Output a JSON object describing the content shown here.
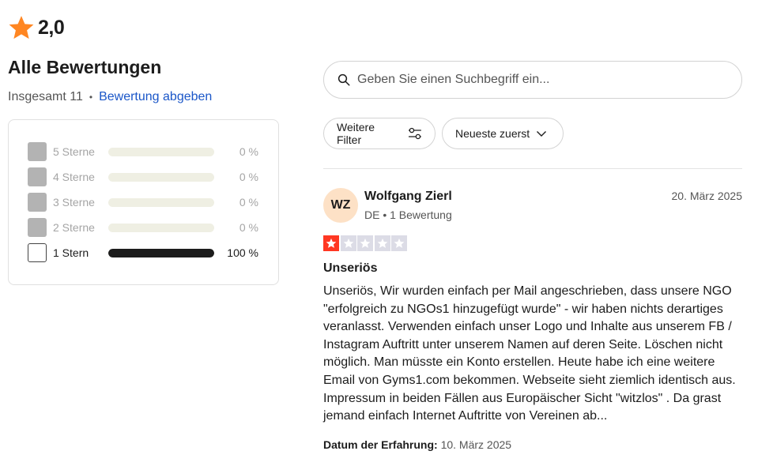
{
  "rating": {
    "score": "2,0",
    "icon": "star-icon",
    "icon_color": "#ff8622"
  },
  "title": "Alle Bewertungen",
  "summary": {
    "total_label": "Insgesamt 11",
    "separator": "•",
    "write_review_link": "Bewertung abgeben"
  },
  "distribution": [
    {
      "label": "5 Sterne",
      "percent_label": "0 %",
      "fraction": 0,
      "selected": false
    },
    {
      "label": "4 Sterne",
      "percent_label": "0 %",
      "fraction": 0,
      "selected": false
    },
    {
      "label": "3 Sterne",
      "percent_label": "0 %",
      "fraction": 0,
      "selected": false
    },
    {
      "label": "2 Sterne",
      "percent_label": "0 %",
      "fraction": 0,
      "selected": false
    },
    {
      "label": "1 Stern",
      "percent_label": "100 %",
      "fraction": 1,
      "selected": true
    }
  ],
  "search": {
    "placeholder": "Geben Sie einen Suchbegriff ein...",
    "icon": "search-icon"
  },
  "filters": {
    "more_filters_label": "Weitere Filter",
    "sort_label": "Neueste zuerst"
  },
  "review": {
    "avatar_initials": "WZ",
    "avatar_color": "#fde1c6",
    "reviewer_name": "Wolfgang Zierl",
    "reviewer_meta": "DE • 1 Bewertung",
    "date": "20. März 2025",
    "stars": 1,
    "star_color": "#ff3722",
    "title": "Unseriös",
    "body": "Unseriös, Wir wurden einfach per Mail angeschrieben, dass unsere NGO \"erfolgreich zu NGOs1 hinzugefügt wurde\" - wir haben nichts derartiges veranlasst. Verwenden einfach unser Logo und Inhalte aus unserem FB / Instagram Auftritt unter unserem Namen auf deren Seite. Löschen nicht möglich. Man müsste ein Konto erstellen. Heute habe ich eine weitere Email von Gyms1.com bekommen. Webseite sieht ziemlich identisch aus. Impressum in beiden Fällen aus Europäischer Sicht \"witzlos\" . Da grast jemand einfach Internet Auftritte von Vereinen ab...",
    "experience_label": "Datum der Erfahrung:",
    "experience_date": "10. März 2025"
  }
}
